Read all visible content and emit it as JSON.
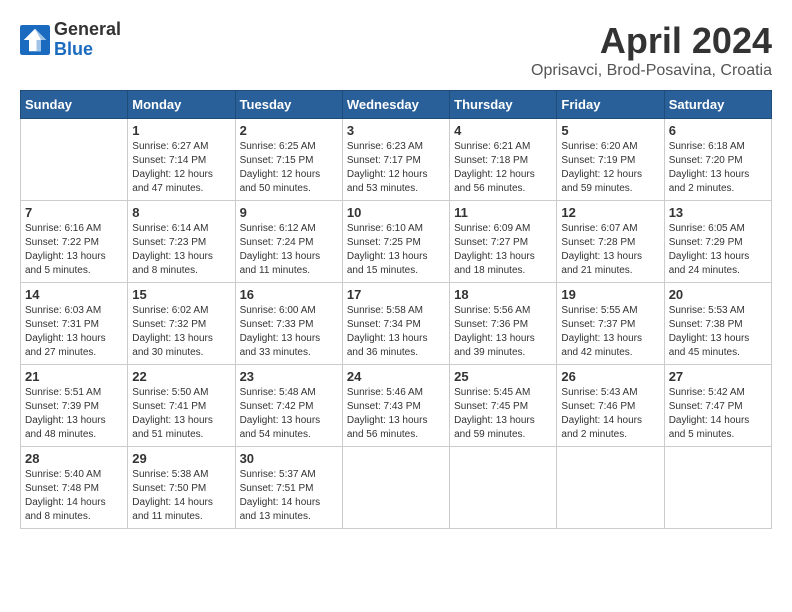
{
  "header": {
    "logo_general": "General",
    "logo_blue": "Blue",
    "month_title": "April 2024",
    "subtitle": "Oprisavci, Brod-Posavina, Croatia"
  },
  "weekdays": [
    "Sunday",
    "Monday",
    "Tuesday",
    "Wednesday",
    "Thursday",
    "Friday",
    "Saturday"
  ],
  "weeks": [
    [
      {
        "day": "",
        "info": ""
      },
      {
        "day": "1",
        "info": "Sunrise: 6:27 AM\nSunset: 7:14 PM\nDaylight: 12 hours\nand 47 minutes."
      },
      {
        "day": "2",
        "info": "Sunrise: 6:25 AM\nSunset: 7:15 PM\nDaylight: 12 hours\nand 50 minutes."
      },
      {
        "day": "3",
        "info": "Sunrise: 6:23 AM\nSunset: 7:17 PM\nDaylight: 12 hours\nand 53 minutes."
      },
      {
        "day": "4",
        "info": "Sunrise: 6:21 AM\nSunset: 7:18 PM\nDaylight: 12 hours\nand 56 minutes."
      },
      {
        "day": "5",
        "info": "Sunrise: 6:20 AM\nSunset: 7:19 PM\nDaylight: 12 hours\nand 59 minutes."
      },
      {
        "day": "6",
        "info": "Sunrise: 6:18 AM\nSunset: 7:20 PM\nDaylight: 13 hours\nand 2 minutes."
      }
    ],
    [
      {
        "day": "7",
        "info": "Sunrise: 6:16 AM\nSunset: 7:22 PM\nDaylight: 13 hours\nand 5 minutes."
      },
      {
        "day": "8",
        "info": "Sunrise: 6:14 AM\nSunset: 7:23 PM\nDaylight: 13 hours\nand 8 minutes."
      },
      {
        "day": "9",
        "info": "Sunrise: 6:12 AM\nSunset: 7:24 PM\nDaylight: 13 hours\nand 11 minutes."
      },
      {
        "day": "10",
        "info": "Sunrise: 6:10 AM\nSunset: 7:25 PM\nDaylight: 13 hours\nand 15 minutes."
      },
      {
        "day": "11",
        "info": "Sunrise: 6:09 AM\nSunset: 7:27 PM\nDaylight: 13 hours\nand 18 minutes."
      },
      {
        "day": "12",
        "info": "Sunrise: 6:07 AM\nSunset: 7:28 PM\nDaylight: 13 hours\nand 21 minutes."
      },
      {
        "day": "13",
        "info": "Sunrise: 6:05 AM\nSunset: 7:29 PM\nDaylight: 13 hours\nand 24 minutes."
      }
    ],
    [
      {
        "day": "14",
        "info": "Sunrise: 6:03 AM\nSunset: 7:31 PM\nDaylight: 13 hours\nand 27 minutes."
      },
      {
        "day": "15",
        "info": "Sunrise: 6:02 AM\nSunset: 7:32 PM\nDaylight: 13 hours\nand 30 minutes."
      },
      {
        "day": "16",
        "info": "Sunrise: 6:00 AM\nSunset: 7:33 PM\nDaylight: 13 hours\nand 33 minutes."
      },
      {
        "day": "17",
        "info": "Sunrise: 5:58 AM\nSunset: 7:34 PM\nDaylight: 13 hours\nand 36 minutes."
      },
      {
        "day": "18",
        "info": "Sunrise: 5:56 AM\nSunset: 7:36 PM\nDaylight: 13 hours\nand 39 minutes."
      },
      {
        "day": "19",
        "info": "Sunrise: 5:55 AM\nSunset: 7:37 PM\nDaylight: 13 hours\nand 42 minutes."
      },
      {
        "day": "20",
        "info": "Sunrise: 5:53 AM\nSunset: 7:38 PM\nDaylight: 13 hours\nand 45 minutes."
      }
    ],
    [
      {
        "day": "21",
        "info": "Sunrise: 5:51 AM\nSunset: 7:39 PM\nDaylight: 13 hours\nand 48 minutes."
      },
      {
        "day": "22",
        "info": "Sunrise: 5:50 AM\nSunset: 7:41 PM\nDaylight: 13 hours\nand 51 minutes."
      },
      {
        "day": "23",
        "info": "Sunrise: 5:48 AM\nSunset: 7:42 PM\nDaylight: 13 hours\nand 54 minutes."
      },
      {
        "day": "24",
        "info": "Sunrise: 5:46 AM\nSunset: 7:43 PM\nDaylight: 13 hours\nand 56 minutes."
      },
      {
        "day": "25",
        "info": "Sunrise: 5:45 AM\nSunset: 7:45 PM\nDaylight: 13 hours\nand 59 minutes."
      },
      {
        "day": "26",
        "info": "Sunrise: 5:43 AM\nSunset: 7:46 PM\nDaylight: 14 hours\nand 2 minutes."
      },
      {
        "day": "27",
        "info": "Sunrise: 5:42 AM\nSunset: 7:47 PM\nDaylight: 14 hours\nand 5 minutes."
      }
    ],
    [
      {
        "day": "28",
        "info": "Sunrise: 5:40 AM\nSunset: 7:48 PM\nDaylight: 14 hours\nand 8 minutes."
      },
      {
        "day": "29",
        "info": "Sunrise: 5:38 AM\nSunset: 7:50 PM\nDaylight: 14 hours\nand 11 minutes."
      },
      {
        "day": "30",
        "info": "Sunrise: 5:37 AM\nSunset: 7:51 PM\nDaylight: 14 hours\nand 13 minutes."
      },
      {
        "day": "",
        "info": ""
      },
      {
        "day": "",
        "info": ""
      },
      {
        "day": "",
        "info": ""
      },
      {
        "day": "",
        "info": ""
      }
    ]
  ]
}
